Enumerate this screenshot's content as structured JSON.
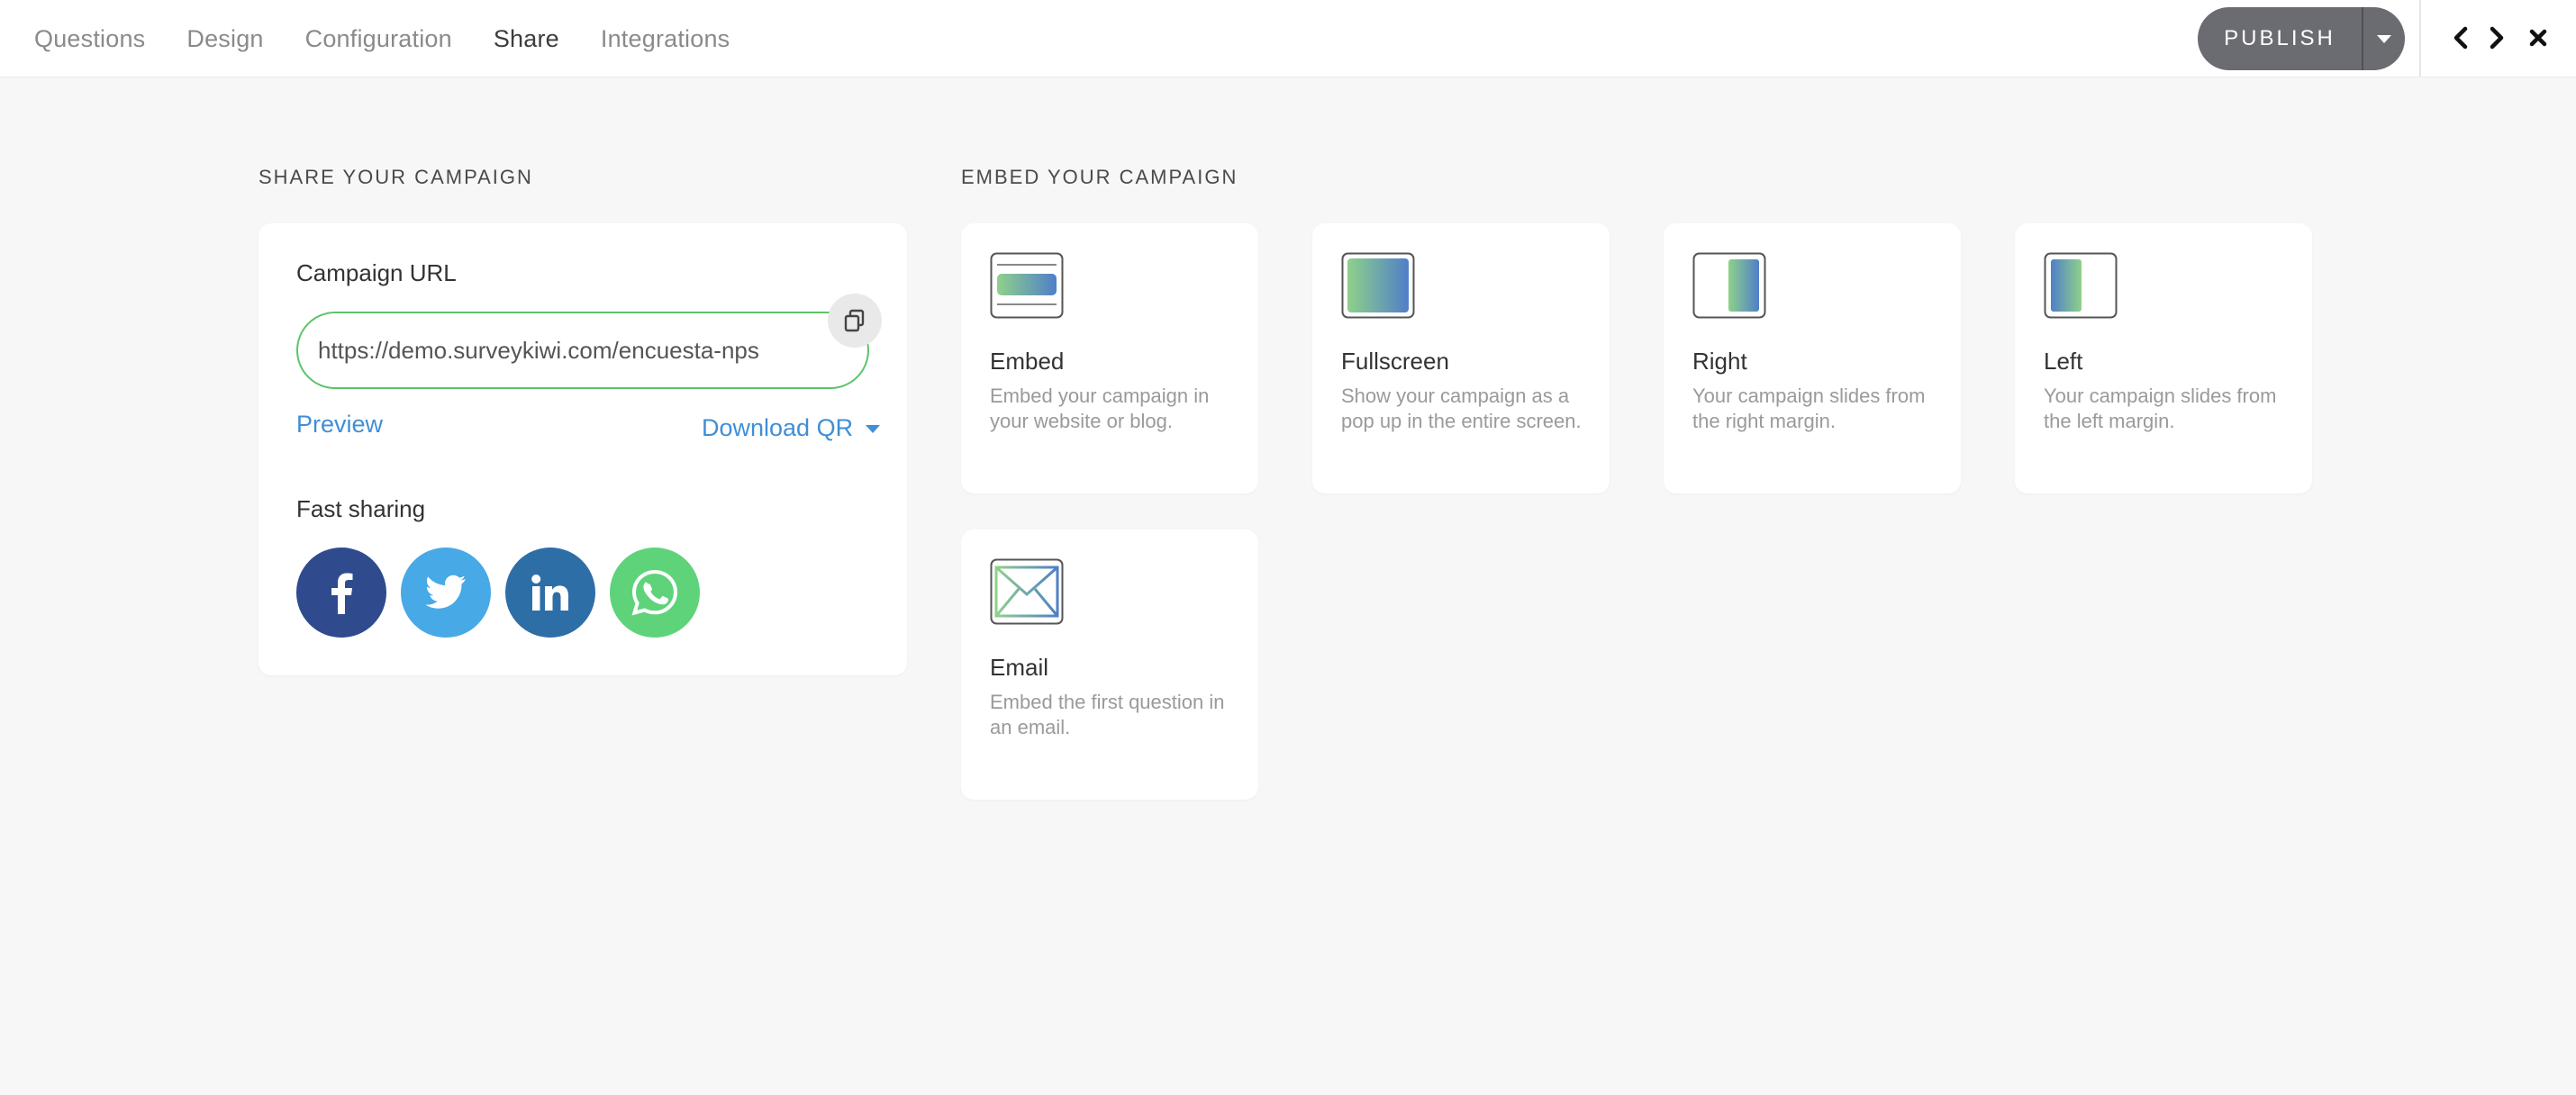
{
  "nav": {
    "tabs": [
      {
        "label": "Questions"
      },
      {
        "label": "Design"
      },
      {
        "label": "Configuration"
      },
      {
        "label": "Share"
      },
      {
        "label": "Integrations"
      }
    ],
    "active_tab": "Share",
    "publish_label": "PUBLISH",
    "icons": [
      "chevron-left-icon",
      "chevron-right-icon",
      "close-icon"
    ]
  },
  "share": {
    "section_title": "SHARE YOUR CAMPAIGN",
    "url_label": "Campaign URL",
    "url_value": "https://demo.surveykiwi.com/encuesta-nps",
    "preview_label": "Preview",
    "download_qr_label": "Download QR",
    "fast_sharing_label": "Fast sharing",
    "social": [
      {
        "name": "facebook-icon",
        "color": "#2f4b8e"
      },
      {
        "name": "twitter-icon",
        "color": "#47a9e5"
      },
      {
        "name": "linkedin-icon",
        "color": "#2e6ea7"
      },
      {
        "name": "whatsapp-icon",
        "color": "#5fd37a"
      }
    ]
  },
  "embed": {
    "section_title": "EMBED YOUR CAMPAIGN",
    "options": [
      {
        "title": "Embed",
        "description": "Embed your campaign in your website or blog.",
        "icon": "embed-icon"
      },
      {
        "title": "Fullscreen",
        "description": "Show your campaign as a pop up in the entire screen.",
        "icon": "fullscreen-icon"
      },
      {
        "title": "Right",
        "description": "Your campaign slides from the right margin.",
        "icon": "right-panel-icon"
      },
      {
        "title": "Left",
        "description": "Your campaign slides from the left margin.",
        "icon": "left-panel-icon"
      },
      {
        "title": "Email",
        "description": "Embed the first question in an email.",
        "icon": "email-icon"
      }
    ]
  },
  "colors": {
    "accent_green": "#5cc46a",
    "link_blue": "#3f8fd6",
    "publish_gray": "#6b6b72",
    "gradient_green": "#8fd18a",
    "gradient_blue": "#4f7fc9"
  }
}
